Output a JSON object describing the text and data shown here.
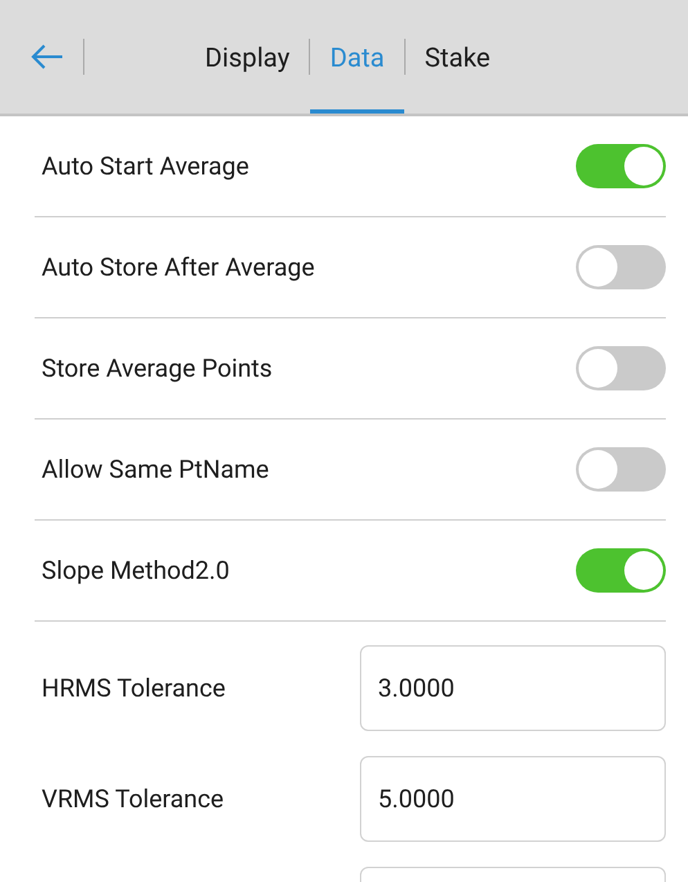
{
  "tabs": [
    {
      "label": "Display",
      "selected": false
    },
    {
      "label": "Data",
      "selected": true
    },
    {
      "label": "Stake",
      "selected": false
    }
  ],
  "settings": [
    {
      "kind": "toggle",
      "label": "Auto Start Average",
      "on": true
    },
    {
      "kind": "toggle",
      "label": "Auto Store After Average",
      "on": false
    },
    {
      "kind": "toggle",
      "label": "Store Average Points",
      "on": false
    },
    {
      "kind": "toggle",
      "label": "Allow Same PtName",
      "on": false
    },
    {
      "kind": "toggle",
      "label": "Slope Method2.0",
      "on": true
    },
    {
      "kind": "field",
      "label": "HRMS Tolerance",
      "value": "3.0000"
    },
    {
      "kind": "field",
      "label": "VRMS Tolerance",
      "value": "5.0000"
    },
    {
      "kind": "field"
    }
  ]
}
